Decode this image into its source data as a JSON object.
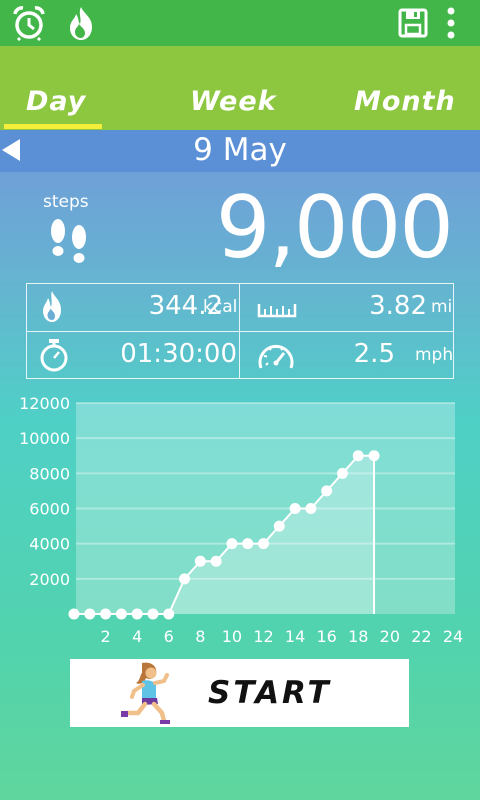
{
  "topbar": {
    "icons": [
      "alarm-clock-icon",
      "flame-icon",
      "save-icon",
      "more-vert-icon"
    ],
    "colors": {
      "bar": "#43b649"
    }
  },
  "tabs": {
    "items": [
      {
        "label": "Day",
        "selected": true
      },
      {
        "label": "Week",
        "selected": false
      },
      {
        "label": "Month",
        "selected": false
      }
    ],
    "colors": {
      "bar": "#8dc63f",
      "underline": "#f2ee3a"
    }
  },
  "date": {
    "label": "9 May"
  },
  "steps": {
    "label": "steps",
    "value": "9,000"
  },
  "stats": {
    "calories": {
      "value": "344.2",
      "unit": "kcal"
    },
    "distance": {
      "value": "3.82",
      "unit": "mi"
    },
    "duration": {
      "value": "01:30:00"
    },
    "speed": {
      "value": "2.5",
      "unit": "mph"
    }
  },
  "chart_data": {
    "type": "area",
    "x": [
      0,
      1,
      2,
      3,
      4,
      5,
      6,
      7,
      8,
      9,
      10,
      11,
      12,
      13,
      14,
      15,
      16,
      17,
      18,
      19
    ],
    "values": [
      0,
      0,
      0,
      0,
      0,
      0,
      0,
      2000,
      3000,
      3000,
      4000,
      4000,
      4000,
      5000,
      6000,
      6000,
      7000,
      8000,
      9000,
      9000
    ],
    "xlim": [
      0,
      24
    ],
    "ylim": [
      0,
      12000
    ],
    "x_ticks": [
      "2",
      "4",
      "6",
      "8",
      "10",
      "12",
      "14",
      "16",
      "18",
      "20",
      "22",
      "24"
    ],
    "y_ticks": [
      "2000",
      "4000",
      "6000",
      "8000",
      "10000",
      "12000"
    ],
    "grid": true
  },
  "start_button": {
    "label": "START"
  }
}
